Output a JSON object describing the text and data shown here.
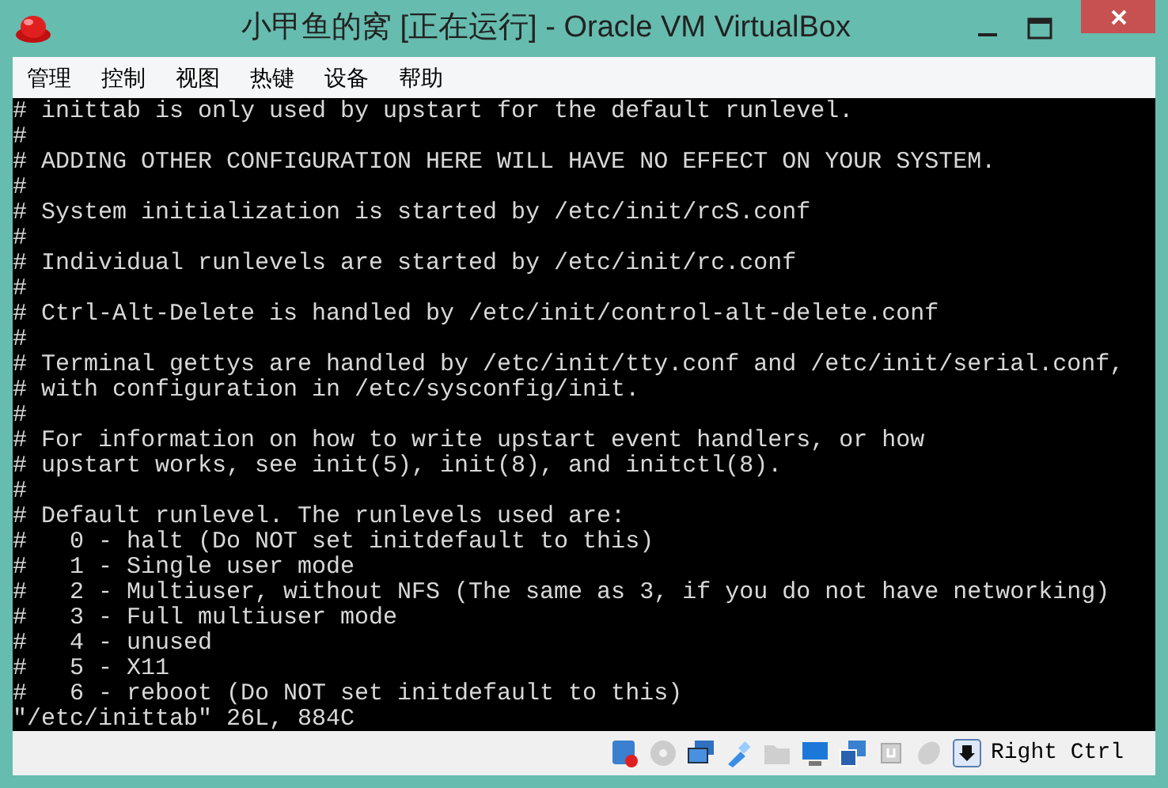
{
  "window": {
    "title": "小甲鱼的窝 [正在运行] - Oracle VM VirtualBox"
  },
  "menu": [
    "管理",
    "控制",
    "视图",
    "热键",
    "设备",
    "帮助"
  ],
  "terminal": {
    "lines": [
      "# inittab is only used by upstart for the default runlevel.",
      "#",
      "# ADDING OTHER CONFIGURATION HERE WILL HAVE NO EFFECT ON YOUR SYSTEM.",
      "#",
      "# System initialization is started by /etc/init/rcS.conf",
      "#",
      "# Individual runlevels are started by /etc/init/rc.conf",
      "#",
      "# Ctrl-Alt-Delete is handled by /etc/init/control-alt-delete.conf",
      "#",
      "# Terminal gettys are handled by /etc/init/tty.conf and /etc/init/serial.conf,",
      "# with configuration in /etc/sysconfig/init.",
      "#",
      "# For information on how to write upstart event handlers, or how",
      "# upstart works, see init(5), init(8), and initctl(8).",
      "#",
      "# Default runlevel. The runlevels used are:",
      "#   0 - halt (Do NOT set initdefault to this)",
      "#   1 - Single user mode",
      "#   2 - Multiuser, without NFS (The same as 3, if you do not have networking)",
      "#   3 - Full multiuser mode",
      "#   4 - unused",
      "#   5 - X11",
      "#   6 - reboot (Do NOT set initdefault to this)",
      "\"/etc/inittab\" 26L, 884C"
    ]
  },
  "status_bar": {
    "host_key": "Right Ctrl"
  }
}
